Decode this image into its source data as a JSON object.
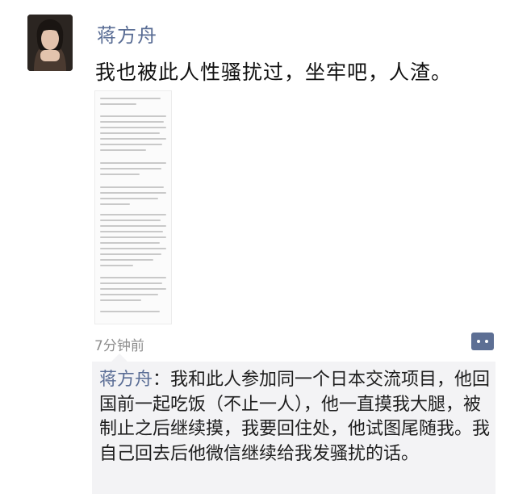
{
  "post": {
    "author": "蒋方舟",
    "content": "我也被此人性骚扰过，坐牢吧，人渣。",
    "time": "7分钟前"
  },
  "comment": {
    "author": "蒋方舟",
    "separator": "：",
    "text": "我和此人参加同一个日本交流项目，他回国前一起吃饭（不止一人），他一直摸我大腿，被制止之后继续摸，我要回住处，他试图尾随我。我自己回去后他微信继续给我发骚扰的话。"
  },
  "icons": {
    "comment_button": "comment-bubble-icon"
  },
  "colors": {
    "author_name": "#5a6d95",
    "comment_bg": "#f3f3f5",
    "timestamp": "#8d8d8d"
  }
}
